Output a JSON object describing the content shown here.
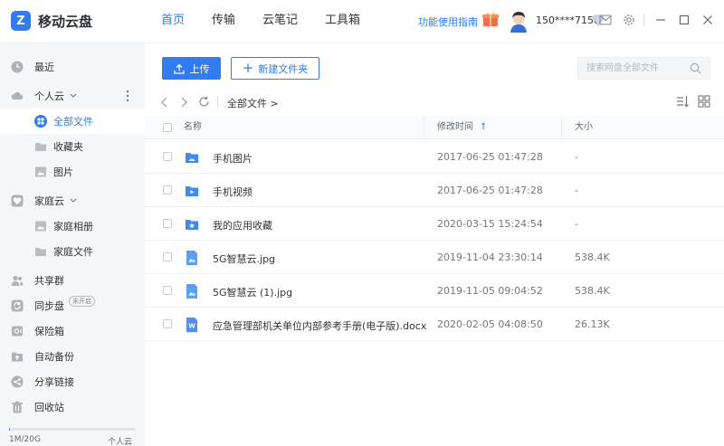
{
  "app": {
    "name": "移动云盘",
    "logo_letter": "Z"
  },
  "nav": [
    {
      "label": "首页",
      "active": true
    },
    {
      "label": "传输",
      "active": false
    },
    {
      "label": "云笔记",
      "active": false
    },
    {
      "label": "工具箱",
      "active": false
    }
  ],
  "header": {
    "guide": "功能使用指南",
    "phone": "150****7158"
  },
  "sidebar": {
    "recent": "最近",
    "personal": "个人云",
    "all_files": "全部文件",
    "favorites": "收藏夹",
    "pictures": "图片",
    "family": "家庭云",
    "family_album": "家庭相册",
    "family_files": "家庭文件",
    "share_group": "共享群",
    "sync": "同步盘",
    "sync_badge": "未开启",
    "safe": "保险箱",
    "backup": "自动备份",
    "share_link": "分享链接",
    "recycle": "回收站",
    "storage_used": "1M/20G",
    "storage_label": "个人云",
    "storage_fraction": 0.0001
  },
  "toolbar": {
    "upload": "上传",
    "new_folder": "新建文件夹",
    "search_placeholder": "搜索网盘全部文件"
  },
  "path": {
    "crumb": "全部文件 >"
  },
  "columns": {
    "name": "名称",
    "modified": "修改时间",
    "sort_arrow": "↑",
    "size": "大小"
  },
  "files": [
    {
      "name": "手机图片",
      "time": "2017-06-25 01:47:28",
      "size": "-",
      "type": "folder-image"
    },
    {
      "name": "手机视频",
      "time": "2017-06-25 01:47:28",
      "size": "-",
      "type": "folder-video"
    },
    {
      "name": "我的应用收藏",
      "time": "2020-03-15 15:24:54",
      "size": "-",
      "type": "folder-star"
    },
    {
      "name": "5G智慧云.jpg",
      "time": "2019-11-04 23:30:14",
      "size": "538.4K",
      "type": "image"
    },
    {
      "name": "5G智慧云 (1).jpg",
      "time": "2019-11-05 09:04:52",
      "size": "538.4K",
      "type": "image"
    },
    {
      "name": "应急管理部机关单位内部参考手册(电子版).docx",
      "time": "2020-02-05 04:08:50",
      "size": "26.13K",
      "type": "word"
    }
  ],
  "colors": {
    "accent": "#2f7cf6",
    "sidebar_bg": "#f5f6f8"
  }
}
